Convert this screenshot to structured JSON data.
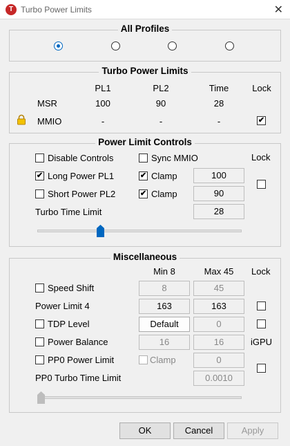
{
  "window": {
    "title": "Turbo Power Limits",
    "app_icon_letter": "T",
    "close_glyph": "✕"
  },
  "all_profiles": {
    "title": "All Profiles",
    "radios": [
      {
        "checked": true
      },
      {
        "checked": false
      },
      {
        "checked": false
      },
      {
        "checked": false
      }
    ]
  },
  "turbo_power_limits": {
    "title": "Turbo Power Limits",
    "headers": {
      "pl1": "PL1",
      "pl2": "PL2",
      "time": "Time",
      "lock": "Lock"
    },
    "rows": [
      {
        "label": "MSR",
        "pl1": "100",
        "pl2": "90",
        "time": "28"
      },
      {
        "label": "MMIO",
        "pl1": "-",
        "pl2": "-",
        "time": "-",
        "lock_checked": true
      }
    ]
  },
  "power_limit_controls": {
    "title": "Power Limit Controls",
    "lock_label": "Lock",
    "disable_controls": {
      "label": "Disable Controls",
      "checked": false
    },
    "sync_mmio": {
      "label": "Sync MMIO",
      "checked": false
    },
    "long_power": {
      "label": "Long Power PL1",
      "checked": true,
      "clamp_label": "Clamp",
      "clamp_checked": true,
      "value": "100"
    },
    "short_power": {
      "label": "Short Power PL2",
      "checked": false,
      "clamp_label": "Clamp",
      "clamp_checked": true,
      "value": "90"
    },
    "turbo_time": {
      "label": "Turbo Time Limit",
      "value": "28"
    },
    "slider_position": 0.3,
    "lock_checked": false
  },
  "miscellaneous": {
    "title": "Miscellaneous",
    "min_header": "Min  8",
    "max_header": "Max  45",
    "lock_label": "Lock",
    "speed_shift": {
      "label": "Speed Shift",
      "checked": false,
      "min": "8",
      "max": "45"
    },
    "power_limit_4": {
      "label": "Power Limit 4",
      "min": "163",
      "max": "163",
      "lock_checked": false
    },
    "tdp_level": {
      "label": "TDP Level",
      "checked": false,
      "button": "Default",
      "value": "0",
      "lock_checked": false
    },
    "power_balance": {
      "label": "Power Balance",
      "checked": false,
      "min": "16",
      "max": "16",
      "igpu_label": "iGPU"
    },
    "pp0_power_limit": {
      "label": "PP0 Power Limit",
      "checked": false,
      "clamp_label": "Clamp",
      "value": "0",
      "lock_checked": false
    },
    "pp0_turbo_time": {
      "label": "PP0 Turbo Time Limit",
      "value": "0.0010"
    },
    "slider_position": 0.0
  },
  "buttons": {
    "ok": "OK",
    "cancel": "Cancel",
    "apply": "Apply"
  },
  "colors": {
    "accent": "#0067c0",
    "app_icon": "#c62828"
  }
}
